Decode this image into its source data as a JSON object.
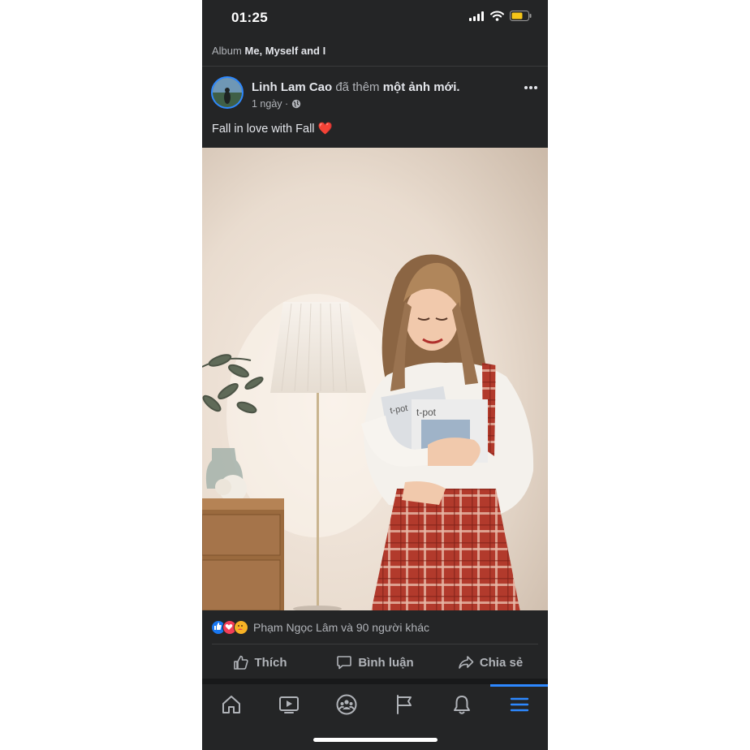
{
  "status": {
    "time": "01:25"
  },
  "album": {
    "prefix": "Album",
    "name": "Me, Myself and I"
  },
  "post": {
    "author": "Linh Lam Cao",
    "action_text": "đã thêm",
    "action_object": "một ảnh mới.",
    "time": "1 ngày ·",
    "caption": "Fall in love with Fall",
    "caption_emoji": "❤️",
    "photo_labels": {
      "book_front": "t-pot",
      "book_back": "t-pot"
    }
  },
  "reactions": {
    "text": "Phạm Ngọc Lâm và 90 người khác"
  },
  "actions": {
    "like": "Thích",
    "comment": "Bình luận",
    "share": "Chia sẻ"
  },
  "tabbar": {
    "items": [
      "home-icon",
      "video-icon",
      "groups-icon",
      "pages-flag-icon",
      "notifications-icon",
      "menu-icon"
    ],
    "active_index": 5
  },
  "colors": {
    "accent": "#2d88ff",
    "background": "#242526",
    "text": "#e4e6eb",
    "secondary_text": "#b0b3b8"
  }
}
